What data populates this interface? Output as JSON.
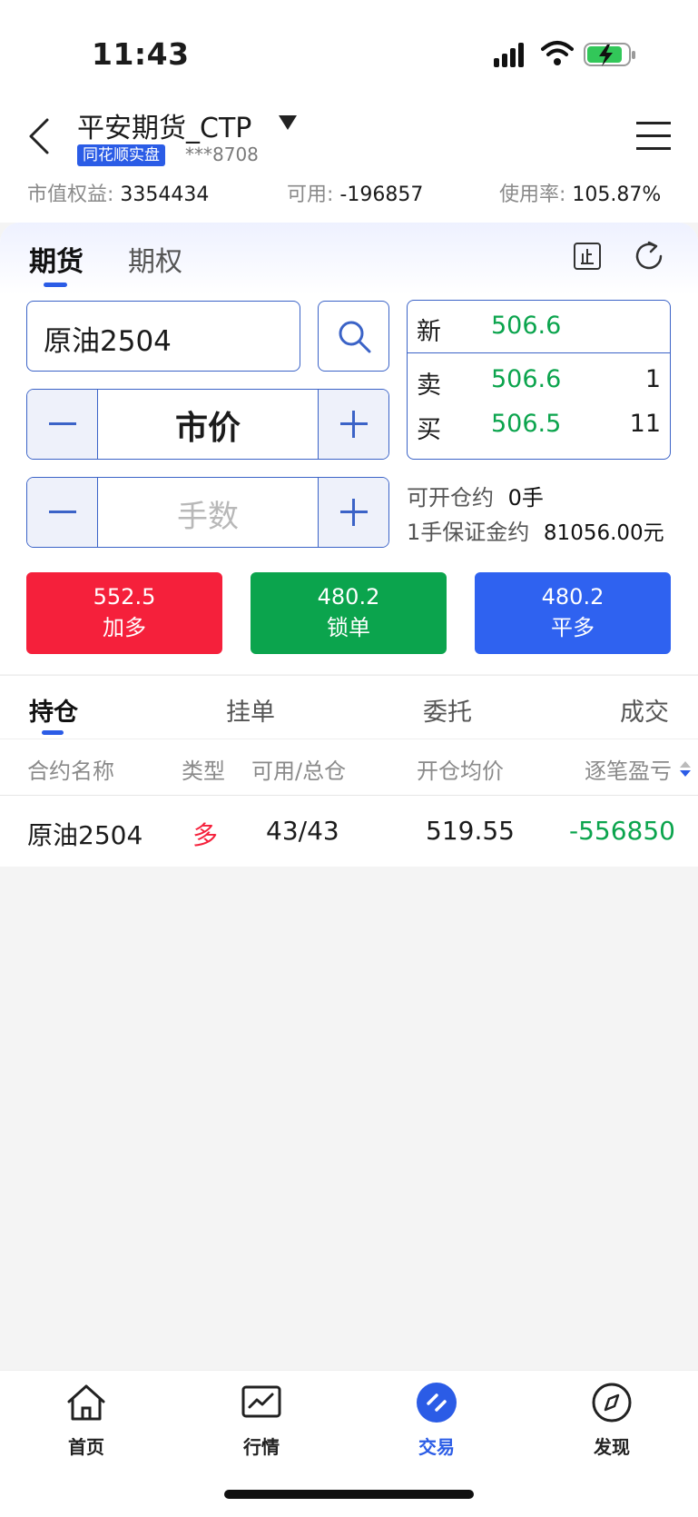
{
  "status_bar": {
    "time": "11:43"
  },
  "header": {
    "title": "平安期货_CTP",
    "broker_tag": "同花顺实盘",
    "account_masked": "***8708",
    "equity_label": "市值权益:",
    "equity_value": "3354434",
    "available_label": "可用:",
    "available_value": "-196857",
    "usage_label": "使用率:",
    "usage_value": "105.87%"
  },
  "trade_tabs": {
    "futures": "期货",
    "options": "期权"
  },
  "order": {
    "contract_value": "原油2504",
    "price_value": "市价",
    "lots_placeholder": "手数",
    "open_label": "可开仓约",
    "open_value": "0手",
    "margin_label": "1手保证金约",
    "margin_value": "81056.00元"
  },
  "quote": {
    "last_label": "新",
    "last_price": "506.6",
    "ask_label": "卖",
    "ask_price": "506.6",
    "ask_volume": "1",
    "bid_label": "买",
    "bid_price": "506.5",
    "bid_volume": "11"
  },
  "actions": {
    "add_long_price": "552.5",
    "add_long_label": "加多",
    "lock_price": "480.2",
    "lock_label": "锁单",
    "close_long_price": "480.2",
    "close_long_label": "平多"
  },
  "position_tabs": [
    "持仓",
    "挂单",
    "委托",
    "成交"
  ],
  "table": {
    "headers": [
      "合约名称",
      "类型",
      "可用/总仓",
      "开仓均价",
      "逐笔盈亏"
    ],
    "rows": [
      {
        "contract": "原油2504",
        "type": "多",
        "avail_total": "43/43",
        "avg_price": "519.55",
        "pnl": "-556850"
      }
    ]
  },
  "bottom_nav": [
    "首页",
    "行情",
    "交易",
    "发现"
  ],
  "colors": {
    "accent": "#2b5ce6",
    "red": "#f5203b",
    "green": "#0ba44d",
    "blue": "#2f62f0"
  }
}
